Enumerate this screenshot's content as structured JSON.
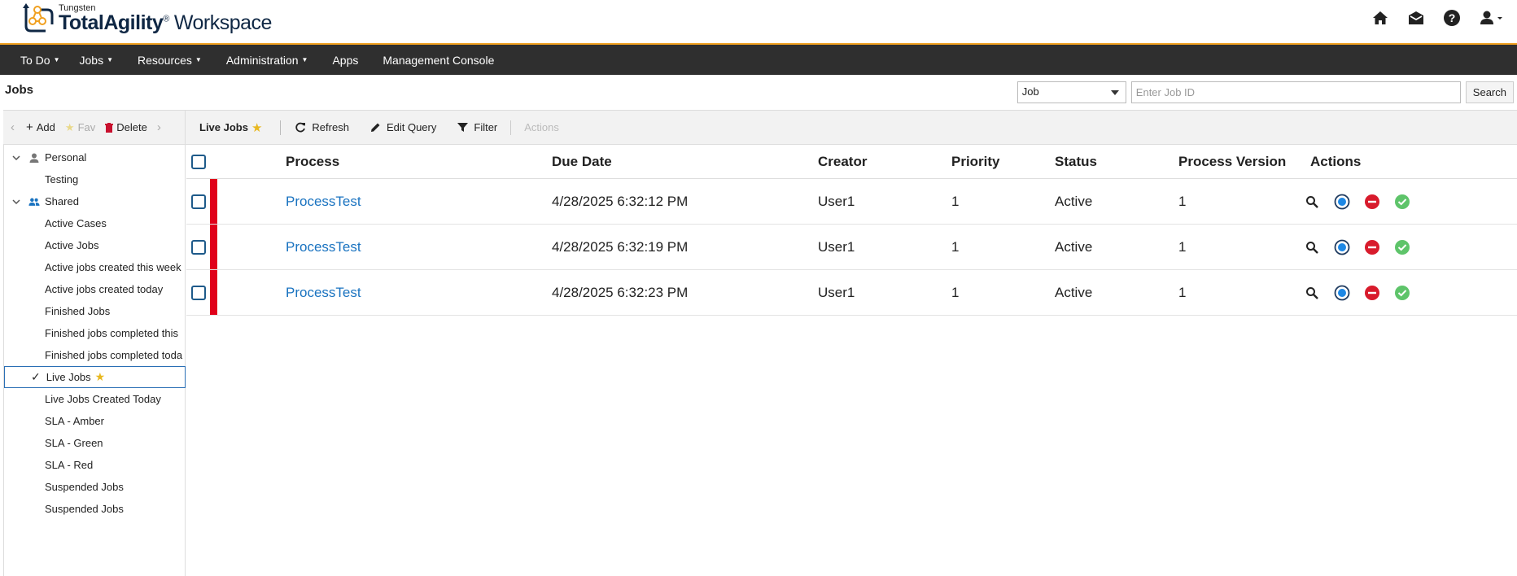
{
  "header": {
    "brand_small": "Tungsten",
    "brand_name": "TotalAgility",
    "brand_reg": "®",
    "brand_suffix": "Workspace",
    "icons": [
      "home-icon",
      "inbox-icon",
      "help-icon",
      "user-icon"
    ]
  },
  "nav": {
    "items": [
      {
        "label": "To Do",
        "caret": true
      },
      {
        "label": "Jobs",
        "caret": true
      },
      {
        "label": "Resources",
        "caret": true
      },
      {
        "label": "Administration",
        "caret": true
      },
      {
        "label": "Apps",
        "caret": false
      },
      {
        "label": "Management Console",
        "caret": false
      }
    ]
  },
  "page": {
    "title": "Jobs",
    "search_type": "Job",
    "search_placeholder": "Enter Job ID",
    "search_button": "Search"
  },
  "toolbar": {
    "add": "Add",
    "fav": "Fav",
    "delete": "Delete",
    "current_view": "Live Jobs",
    "refresh": "Refresh",
    "edit_query": "Edit Query",
    "filter": "Filter",
    "actions": "Actions"
  },
  "sidebar": {
    "personal_label": "Personal",
    "personal_items": [
      "Testing"
    ],
    "shared_label": "Shared",
    "shared_items": [
      "Active Cases",
      "Active Jobs",
      "Active jobs created this week",
      "Active jobs created today",
      "Finished Jobs",
      "Finished jobs completed this",
      "Finished jobs completed toda",
      "Live Jobs",
      "Live Jobs Created Today",
      "SLA - Amber",
      "SLA - Green",
      "SLA - Red",
      "Suspended Jobs",
      "Suspended Jobs"
    ],
    "selected_index": 7
  },
  "table": {
    "columns": [
      "Process",
      "Due Date",
      "Creator",
      "Priority",
      "Status",
      "Process Version",
      "Actions"
    ],
    "rows": [
      {
        "process": "ProcessTest",
        "due": "4/28/2025 6:32:12 PM",
        "creator": "User1",
        "priority": "1",
        "status": "Active",
        "version": "1"
      },
      {
        "process": "ProcessTest",
        "due": "4/28/2025 6:32:19 PM",
        "creator": "User1",
        "priority": "1",
        "status": "Active",
        "version": "1"
      },
      {
        "process": "ProcessTest",
        "due": "4/28/2025 6:32:23 PM",
        "creator": "User1",
        "priority": "1",
        "status": "Active",
        "version": "1"
      }
    ],
    "row_action_icons": [
      "magnifier-icon",
      "target-icon",
      "stop-icon",
      "complete-icon"
    ]
  },
  "colors": {
    "nav_bg": "#2f2f2f",
    "accent_orange": "#f0a020",
    "link_blue": "#1a73c0",
    "flag_red": "#e0001a",
    "star_yellow": "#e8b820"
  }
}
